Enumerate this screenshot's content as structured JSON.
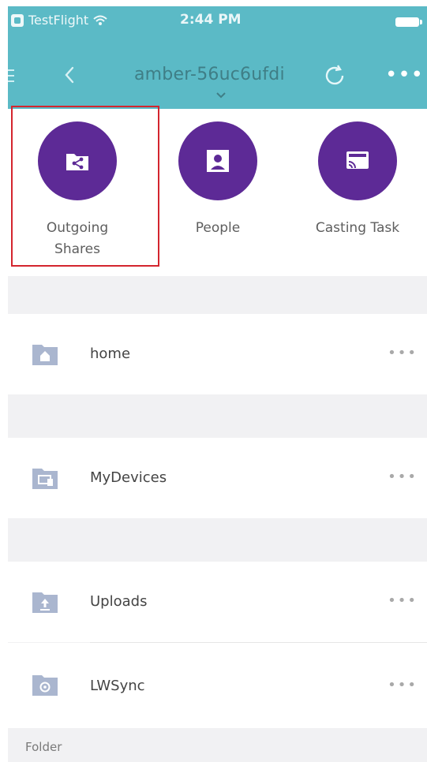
{
  "status_bar": {
    "app_name": "TestFlight",
    "time": "2:44 PM"
  },
  "nav": {
    "title": "amber-56uc6ufdi"
  },
  "quick_actions": [
    {
      "label": "Outgoing Shares",
      "icon": "share-folder-icon",
      "selected": true
    },
    {
      "label": "People",
      "icon": "person-scan-icon",
      "selected": false
    },
    {
      "label": "Casting Task",
      "icon": "cast-icon",
      "selected": false
    }
  ],
  "items": [
    {
      "label": "home",
      "icon": "home-folder-icon"
    },
    {
      "label": "MyDevices",
      "icon": "devices-folder-icon"
    },
    {
      "label": "Uploads",
      "icon": "upload-folder-icon"
    },
    {
      "label": "LWSync",
      "icon": "sync-folder-icon"
    }
  ],
  "section_footer": "Folder",
  "colors": {
    "header": "#5bbac6",
    "accent_purple": "#5d2a96",
    "selection_outline": "#d4252e",
    "folder_icon": "#aab6cf",
    "list_background": "#f1f1f3"
  }
}
